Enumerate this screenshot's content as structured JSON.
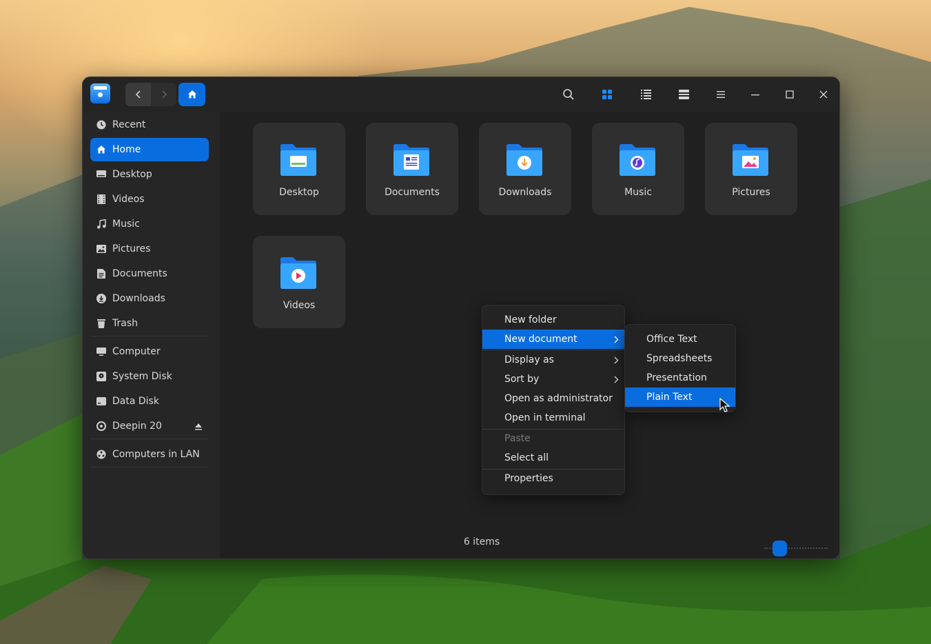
{
  "window": {
    "sidebar": {
      "items": [
        {
          "label": "Recent",
          "icon": "clock-icon",
          "active": false
        },
        {
          "label": "Home",
          "icon": "home-icon",
          "active": true
        },
        {
          "label": "Desktop",
          "icon": "desktop-icon",
          "active": false
        },
        {
          "label": "Videos",
          "icon": "film-icon",
          "active": false
        },
        {
          "label": "Music",
          "icon": "music-icon",
          "active": false
        },
        {
          "label": "Pictures",
          "icon": "picture-icon",
          "active": false
        },
        {
          "label": "Documents",
          "icon": "document-icon",
          "active": false
        },
        {
          "label": "Downloads",
          "icon": "download-icon",
          "active": false
        },
        {
          "label": "Trash",
          "icon": "trash-icon",
          "active": false
        }
      ],
      "devices": [
        {
          "label": "Computer",
          "icon": "computer-icon"
        },
        {
          "label": "System Disk",
          "icon": "disk-icon"
        },
        {
          "label": "Data Disk",
          "icon": "disk-icon"
        },
        {
          "label": "Deepin 20",
          "icon": "optical-disc-icon"
        }
      ],
      "network": [
        {
          "label": "Computers in LAN",
          "icon": "network-icon"
        }
      ]
    },
    "folders": [
      {
        "name": "Desktop",
        "emblem": "desktop"
      },
      {
        "name": "Documents",
        "emblem": "document"
      },
      {
        "name": "Downloads",
        "emblem": "download"
      },
      {
        "name": "Music",
        "emblem": "music"
      },
      {
        "name": "Pictures",
        "emblem": "picture"
      },
      {
        "name": "Videos",
        "emblem": "video"
      }
    ],
    "status_text": "6 items",
    "accent_color": "#0a6ddf"
  },
  "context_menu": {
    "items": [
      {
        "label": "New folder"
      },
      {
        "label": "New document",
        "submenu": true,
        "highlighted": true
      },
      {
        "label": "Display as",
        "submenu": true
      },
      {
        "label": "Sort by",
        "submenu": true
      },
      {
        "label": "Open as administrator"
      },
      {
        "label": "Open in terminal"
      },
      {
        "label": "Paste",
        "disabled": true
      },
      {
        "label": "Select all"
      },
      {
        "label": "Properties"
      }
    ]
  },
  "submenu": {
    "items": [
      {
        "label": "Office Text"
      },
      {
        "label": "Spreadsheets"
      },
      {
        "label": "Presentation"
      },
      {
        "label": "Plain Text",
        "highlighted": true
      }
    ]
  }
}
